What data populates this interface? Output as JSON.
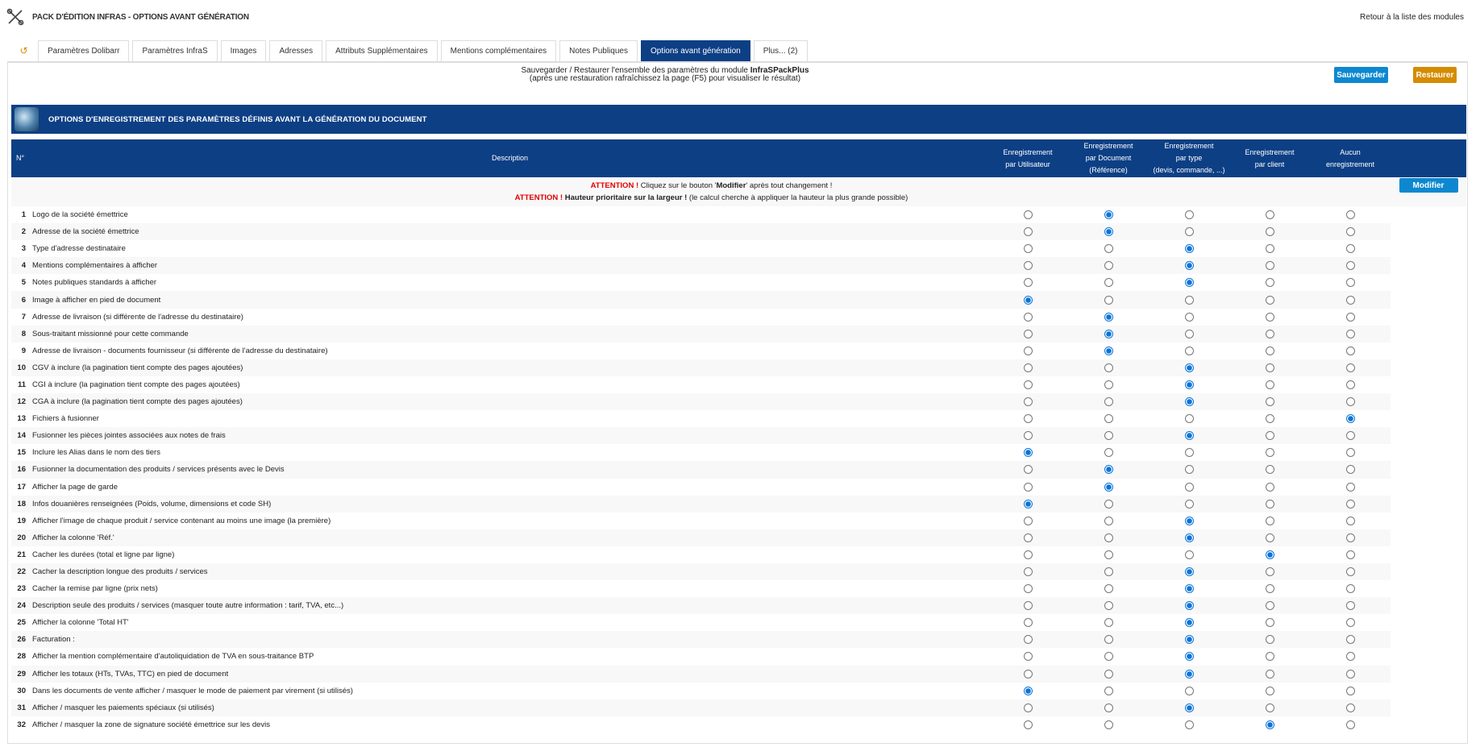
{
  "header": {
    "title": "PACK D'ÉDITION INFRAS - OPTIONS AVANT GÉNÉRATION",
    "back_link": "Retour à la liste des modules"
  },
  "tabs": [
    {
      "label": "Paramètres Dolibarr",
      "active": false
    },
    {
      "label": "Paramètres InfraS",
      "active": false
    },
    {
      "label": "Images",
      "active": false
    },
    {
      "label": "Adresses",
      "active": false
    },
    {
      "label": "Attributs Supplémentaires",
      "active": false
    },
    {
      "label": "Mentions complémentaires",
      "active": false
    },
    {
      "label": "Notes Publiques",
      "active": false
    },
    {
      "label": "Options avant génération",
      "active": true
    },
    {
      "label": "Plus... (2)",
      "active": false
    }
  ],
  "backup": {
    "line1_prefix": "Sauvegarder / Restaurer l'ensemble des paramètres du module ",
    "module": "InfraSPackPlus",
    "line2": "(après une restauration rafraîchissez la page (F5) pour visualiser le résultat)",
    "save_label": "Sauvegarder",
    "restore_label": "Restaurer"
  },
  "banner": {
    "title": "OPTIONS D'ENREGISTREMENT DES PARAMÈTRES DÉFINIS AVANT LA GÉNÉRATION DU DOCUMENT"
  },
  "table": {
    "headers": {
      "num": "N°",
      "description": "Description",
      "cols": [
        [
          "Enregistrement",
          "par Utilisateur"
        ],
        [
          "Enregistrement",
          "par Document",
          "(Référence)"
        ],
        [
          "Enregistrement",
          "par type",
          "(devis, commande, ...)"
        ],
        [
          "Enregistrement",
          "par client"
        ],
        [
          "Aucun",
          "enregistrement"
        ]
      ]
    },
    "attention1": {
      "label": "ATTENTION !",
      "text_a": " Cliquez sur le bouton '",
      "bold": "Modifier",
      "text_b": "' après tout changement !"
    },
    "attention2": {
      "label": "ATTENTION !",
      "bold": " Hauteur prioritaire sur la largeur !",
      "text": " (le calcul cherche à appliquer la hauteur la plus grande possible)"
    },
    "modify_label": "Modifier",
    "rows": [
      {
        "num": "1",
        "desc": "Logo de la société émettrice",
        "sel": 2
      },
      {
        "num": "2",
        "desc": "Adresse de la société émettrice",
        "sel": 2
      },
      {
        "num": "3",
        "desc": "Type d'adresse destinataire",
        "sel": 3
      },
      {
        "num": "4",
        "desc": "Mentions complémentaires à afficher",
        "sel": 3
      },
      {
        "num": "5",
        "desc": "Notes publiques standards à afficher",
        "sel": 3
      },
      {
        "num": "6",
        "desc": "Image à afficher en pied de document",
        "sel": 1
      },
      {
        "num": "7",
        "desc": "Adresse de livraison (si différente de l'adresse du destinataire)",
        "sel": 2
      },
      {
        "num": "8",
        "desc": "Sous-traitant missionné pour cette commande",
        "sel": 2
      },
      {
        "num": "9",
        "desc": "Adresse de livraison - documents fournisseur (si différente de l'adresse du destinataire)",
        "sel": 2
      },
      {
        "num": "10",
        "desc": "CGV à inclure (la pagination tient compte des pages ajoutées)",
        "sel": 3
      },
      {
        "num": "11",
        "desc": "CGI à inclure (la pagination tient compte des pages ajoutées)",
        "sel": 3
      },
      {
        "num": "12",
        "desc": "CGA à inclure (la pagination tient compte des pages ajoutées)",
        "sel": 3
      },
      {
        "num": "13",
        "desc": "Fichiers à fusionner",
        "sel": 5
      },
      {
        "num": "14",
        "desc": "Fusionner les pièces jointes associées aux notes de frais",
        "sel": 3
      },
      {
        "num": "15",
        "desc": "Inclure les Alias dans le nom des tiers",
        "sel": 1
      },
      {
        "num": "16",
        "desc": "Fusionner la documentation des produits / services présents avec le Devis",
        "sel": 2
      },
      {
        "num": "17",
        "desc": "Afficher la page de garde",
        "sel": 2
      },
      {
        "num": "18",
        "desc": "Infos douanières renseignées (Poids, volume, dimensions et code SH)",
        "sel": 1
      },
      {
        "num": "19",
        "desc": "Afficher l'image de chaque produit / service contenant au moins une image (la première)",
        "sel": 3
      },
      {
        "num": "20",
        "desc": "Afficher la colonne 'Réf.'",
        "sel": 3
      },
      {
        "num": "21",
        "desc": "Cacher les durées (total et ligne par ligne)",
        "sel": 4
      },
      {
        "num": "22",
        "desc": "Cacher la description longue des produits / services",
        "sel": 3
      },
      {
        "num": "23",
        "desc": "Cacher la remise par ligne (prix nets)",
        "sel": 3
      },
      {
        "num": "24",
        "desc": "Description seule des produits / services (masquer toute autre information : tarif, TVA, etc...)",
        "sel": 3
      },
      {
        "num": "25",
        "desc": "Afficher la colonne 'Total HT'",
        "sel": 3
      },
      {
        "num": "26",
        "desc": "Facturation :",
        "sel": 3
      },
      {
        "num": "28",
        "desc": "Afficher la mention complémentaire d'autoliquidation de TVA en sous-traitance BTP",
        "sel": 3
      },
      {
        "num": "29",
        "desc": "Afficher les totaux (HTs, TVAs, TTC) en pied de document",
        "sel": 3
      },
      {
        "num": "30",
        "desc": "Dans les documents de vente afficher / masquer le mode de paiement par virement (si utilisés)",
        "sel": 1
      },
      {
        "num": "31",
        "desc": "Afficher / masquer les paiements spéciaux (si utilisés)",
        "sel": 3
      },
      {
        "num": "32",
        "desc": "Afficher / masquer la zone de signature société émettrice sur les devis",
        "sel": 4
      }
    ]
  }
}
